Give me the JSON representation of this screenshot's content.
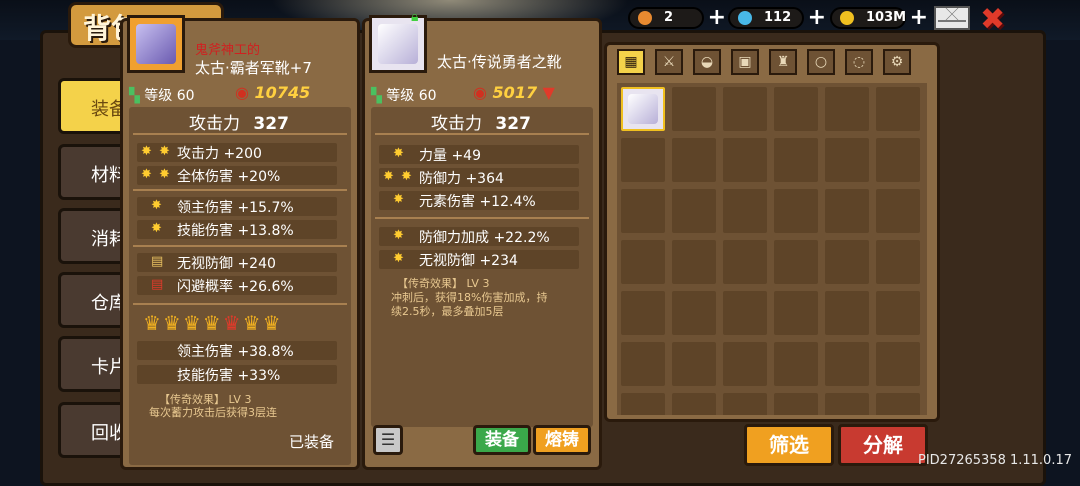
{
  "title": "背包",
  "nav": [
    {
      "label": "装备",
      "active": true
    },
    {
      "label": "材料"
    },
    {
      "label": "消耗"
    },
    {
      "label": "仓库"
    },
    {
      "label": "卡片"
    },
    {
      "label": "回收"
    }
  ],
  "currency": [
    {
      "name": "carrot",
      "value": "2",
      "color": "#e88a30"
    },
    {
      "name": "gem",
      "value": "112",
      "color": "#48b8e8"
    },
    {
      "name": "coin",
      "value": "103M",
      "color": "#f0c020"
    }
  ],
  "equipped_item": {
    "prefix": "鬼斧神工的",
    "name": "太古·霸者军靴+7",
    "level_label": "等级",
    "level": "60",
    "power": "10745",
    "attack_label": "攻击力",
    "attack": "327",
    "stats_main": [
      "攻击力 +200",
      "全体伤害 +20%"
    ],
    "stats_sub": [
      "领主伤害 +15.7%",
      "技能伤害 +13.8%"
    ],
    "stats_extra": [
      "无视防御 +240",
      "闪避概率 +26.6%"
    ],
    "crown_stats": [
      "领主伤害 +38.8%",
      "技能伤害 +33%"
    ],
    "legend_title": "【传奇效果】 LV 3",
    "legend_desc": "每次蓄力攻击后获得3层连",
    "status": "已装备"
  },
  "selected_item": {
    "name": "太古·传说勇者之靴",
    "level_label": "等级",
    "level": "60",
    "power": "5017",
    "power_trend": "down",
    "attack_label": "攻击力",
    "attack": "327",
    "stats_main": [
      "力量 +49",
      "防御力 +364",
      "元素伤害 +12.4%"
    ],
    "stats_sub": [
      "防御力加成 +22.2%",
      "无视防御 +234"
    ],
    "legend_title": "【传奇效果】 LV 3",
    "legend_desc_1": "冲刺后，获得18%伤害加成，持",
    "legend_desc_2": "续2.5秒，最多叠加5层",
    "equip_button": "装备",
    "melt_button": "熔铸"
  },
  "grid_filters": [
    "grid",
    "sword",
    "helmet",
    "armor",
    "boots",
    "ring",
    "necklace",
    "gear"
  ],
  "grid_bottom": {
    "filter_button": "筛选",
    "decompose_button": "分解"
  },
  "pid": "PID27265358 1.11.0.17",
  "colors": {
    "panel": "#8a6a44",
    "yellow": "#f4d24a",
    "red": "#e03a2a",
    "green": "#3aa84a",
    "orange_btn": "#f0a020"
  }
}
